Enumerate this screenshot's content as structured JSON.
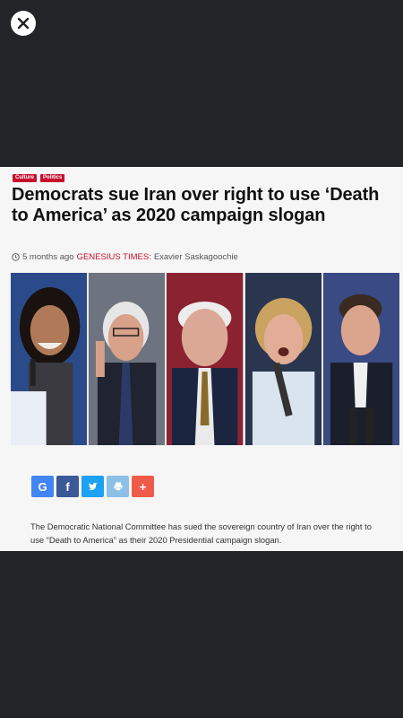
{
  "overlay": {
    "close_icon": "close-icon"
  },
  "article": {
    "tags": [
      "Culture",
      "Politics"
    ],
    "headline": "Democrats sue Iran over right to use ‘Death to America’ as 2020 campaign slogan",
    "meta": {
      "time": "5 months ago",
      "source": "GENESIUS TIMES:",
      "author": "Exavier Saskagoochie"
    },
    "share_buttons": [
      {
        "icon": "google-icon",
        "label": "G",
        "color": "#4285f4"
      },
      {
        "icon": "facebook-icon",
        "label": "f",
        "color": "#3b5998"
      },
      {
        "icon": "twitter-icon",
        "label": "",
        "color": "#1da1f2"
      },
      {
        "icon": "print-icon",
        "label": "",
        "color": "#8cc0e6"
      },
      {
        "icon": "plus-icon",
        "label": "+",
        "color": "#ef5b4a"
      }
    ],
    "body": "The Democratic National Committee has sued the sovereign country of Iran over the right to use “Death to America” as their 2020 Presidential campaign slogan."
  },
  "colors": {
    "background": "#232427",
    "card": "#f6f6f6",
    "accent": "#c8102e"
  }
}
